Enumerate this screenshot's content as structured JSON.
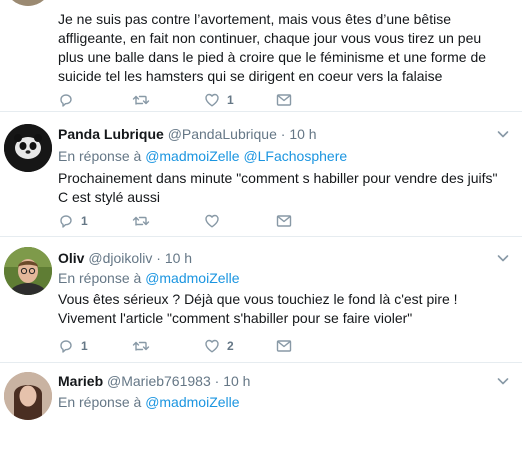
{
  "tweets": [
    {
      "text": "Je ne suis pas contre l’avortement, mais vous êtes d’une bêtise affligeante, en fait non continuer, chaque jour vous vous tirez un peu plus une balle dans le pied à croire que le féminisme et une forme de suicide tel les hamsters qui se dirigent en coeur vers la falaise",
      "replies": "",
      "retweets": "",
      "likes": "1"
    },
    {
      "name": "Panda Lubrique",
      "handle": "@PandaLubrique",
      "sep": "·",
      "time": "10 h",
      "reply_prefix": "En réponse à",
      "reply_to": [
        "@madmoiZelle",
        "@LFachosphere"
      ],
      "text_lines": [
        "Prochainement dans minute \"comment s habiller pour vendre des juifs\"",
        "C est stylé aussi"
      ],
      "replies": "1",
      "retweets": "",
      "likes": ""
    },
    {
      "name": "Oliv",
      "handle": "@djoikoliv",
      "sep": "·",
      "time": "10 h",
      "reply_prefix": "En réponse à",
      "reply_to": [
        "@madmoiZelle"
      ],
      "text": "Vous êtes sérieux ? Déjà que vous touchiez le fond là c'est pire ! Vivement l'article \"comment s'habiller pour se faire violer\"",
      "replies": "1",
      "retweets": "",
      "likes": "2"
    },
    {
      "name": "Marieb",
      "handle": "@Marieb761983",
      "sep": "·",
      "time": "10 h",
      "reply_prefix": "En réponse à",
      "reply_to": [
        "@madmoiZelle"
      ]
    }
  ],
  "icons": {
    "reply": "reply-icon",
    "retweet": "retweet-icon",
    "like": "heart-icon",
    "message": "envelope-icon",
    "more": "chevron-down-icon"
  },
  "colors": {
    "link": "#1b95e0",
    "secondary": "#657786",
    "text": "#14171a",
    "border": "#e6ecf0"
  }
}
